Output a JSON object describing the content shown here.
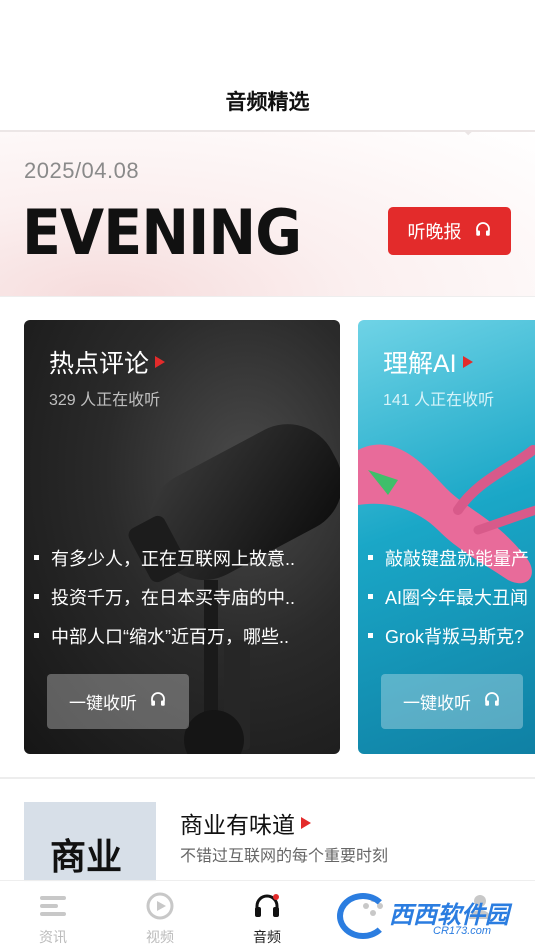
{
  "header": {
    "title": "音频精选"
  },
  "hero": {
    "date": "2025/04.08",
    "headline": "EVENING",
    "listen_button": "听晚报",
    "listen_icon": "headphones-icon"
  },
  "cards": [
    {
      "title": "热点评论",
      "listeners": "329 人正在收听",
      "items": [
        "有多少人，正在互联网上故意..",
        "投资千万，在日本买寺庙的中..",
        "中部人口“缩水”近百万，哪些.."
      ],
      "button": "一键收听"
    },
    {
      "title": "理解AI",
      "listeners": "141 人正在收听",
      "items": [
        "敲敲键盘就能量产",
        "AI圈今年最大丑闻",
        "Grok背叛马斯克?"
      ],
      "button": "一键收听"
    }
  ],
  "program": {
    "thumb_text": "商业",
    "title": "商业有味道",
    "subtitle": "不错过互联网的每个重要时刻"
  },
  "tabs": [
    {
      "label": "资讯",
      "icon": "news-icon",
      "active": false
    },
    {
      "label": "视频",
      "icon": "video-play-icon",
      "active": false
    },
    {
      "label": "音频",
      "icon": "headphones-icon",
      "active": true
    },
    {
      "label": "",
      "icon": "dots-icon",
      "active": false
    },
    {
      "label": "",
      "icon": "profile-icon",
      "active": false
    }
  ],
  "watermark": {
    "text": "西西软件园",
    "url": "CR173.com"
  },
  "colors": {
    "accent": "#e32b2b",
    "card2_bg": "#1aa7c7"
  }
}
